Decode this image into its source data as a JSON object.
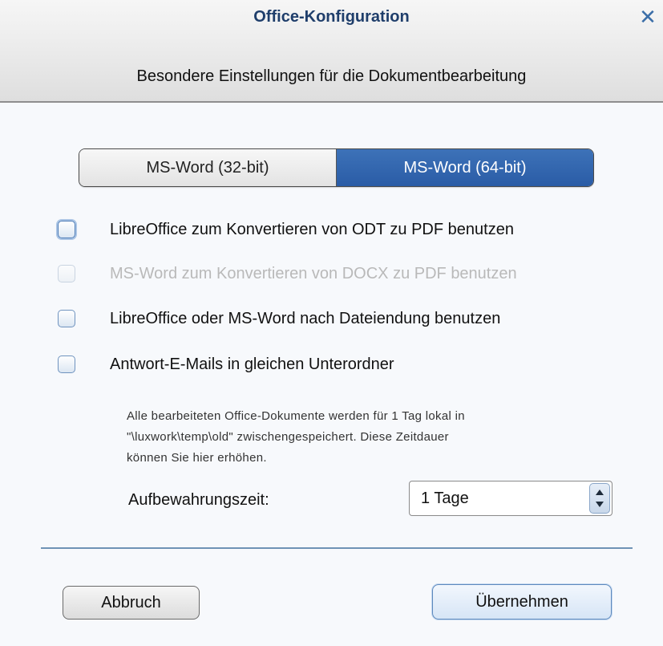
{
  "dialog": {
    "title": "Office-Konfiguration",
    "close_symbol": "✕",
    "subtitle": "Besondere Einstellungen für die Dokumentbearbeitung"
  },
  "segmented": {
    "options": [
      "MS-Word (32-bit)",
      "MS-Word (64-bit)"
    ],
    "selected": "MS-Word (64-bit)"
  },
  "options": [
    {
      "label": "LibreOffice zum Konvertieren von ODT zu PDF benutzen",
      "checked": false,
      "enabled": true
    },
    {
      "label": "MS-Word zum Konvertieren von DOCX zu PDF benutzen",
      "checked": false,
      "enabled": false
    },
    {
      "label": "LibreOffice oder MS-Word nach Dateiendung benutzen",
      "checked": false,
      "enabled": true
    },
    {
      "label": "Antwort-E-Mails in gleichen Unterordner",
      "checked": false,
      "enabled": true
    }
  ],
  "info": {
    "lines": [
      "Alle bearbeiteten Office-Dokumente werden für 1 Tag lokal in",
      "\"\\luxwork\\temp\\old\" zwischengespeichert. Diese Zeitdauer",
      "können Sie hier erhöhen."
    ]
  },
  "retention": {
    "label": "Aufbewahrungszeit:",
    "value": "1 Tage"
  },
  "buttons": {
    "cancel": "Abbruch",
    "apply": "Übernehmen"
  },
  "colors": {
    "title": "#1f3e6b",
    "selected_segment": "#2f62aa",
    "divider": "#6f93b6"
  },
  "icons": {
    "close": "close-icon",
    "spinner": "spinner-arrows-icon"
  }
}
